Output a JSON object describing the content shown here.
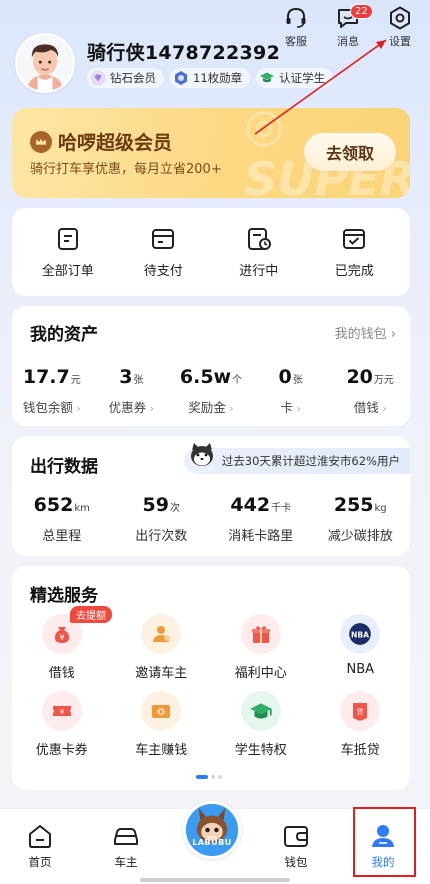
{
  "header": {
    "username": "骑行侠1478722392",
    "badges": [
      {
        "label": "钻石会员",
        "icon": "diamond-icon"
      },
      {
        "label": "11枚勋章",
        "icon": "medal-icon"
      },
      {
        "label": "认证学生",
        "icon": "graduation-cap-icon"
      }
    ],
    "top_actions": [
      {
        "label": "客服",
        "icon": "headset-icon"
      },
      {
        "label": "消息",
        "icon": "message-icon",
        "badge": "22"
      },
      {
        "label": "设置",
        "icon": "gear-icon"
      }
    ]
  },
  "vip": {
    "title": "哈啰超级会员",
    "subtitle": "骑行打车享优惠，每月立省200+",
    "button": "去领取"
  },
  "orders": [
    {
      "label": "全部订单",
      "icon": "orders-icon"
    },
    {
      "label": "待支付",
      "icon": "wallet-card-icon"
    },
    {
      "label": "进行中",
      "icon": "clock-doc-icon"
    },
    {
      "label": "已完成",
      "icon": "check-doc-icon"
    }
  ],
  "assets": {
    "title": "我的资产",
    "link": "我的钱包",
    "items": [
      {
        "value": "17.7",
        "unit": "元",
        "label": "钱包余额"
      },
      {
        "value": "3",
        "unit": "张",
        "label": "优惠券"
      },
      {
        "value": "6.5w",
        "unit": "个",
        "label": "奖励金"
      },
      {
        "value": "0",
        "unit": "张",
        "label": "卡"
      },
      {
        "value": "20",
        "unit": "万元",
        "label": "借钱"
      }
    ]
  },
  "travel": {
    "title": "出行数据",
    "banner": "过去30天累计超过淮安市62%用户",
    "items": [
      {
        "value": "652",
        "unit": "km",
        "label": "总里程"
      },
      {
        "value": "59",
        "unit": "次",
        "label": "出行次数"
      },
      {
        "value": "442",
        "unit": "千卡",
        "label": "消耗卡路里"
      },
      {
        "value": "255",
        "unit": "kg",
        "label": "减少碳排放"
      }
    ]
  },
  "services": {
    "title": "精选服务",
    "tag": "去提额",
    "items": [
      {
        "label": "借钱",
        "icon": "yuan-bag-icon"
      },
      {
        "label": "邀请车主",
        "icon": "invite-driver-icon"
      },
      {
        "label": "福利中心",
        "icon": "gift-icon"
      },
      {
        "label": "NBA",
        "icon": "nba-logo-icon"
      },
      {
        "label": "优惠卡券",
        "icon": "coupon-icon"
      },
      {
        "label": "车主赚钱",
        "icon": "driver-earn-icon"
      },
      {
        "label": "学生特权",
        "icon": "graduation-cap-icon"
      },
      {
        "label": "车抵贷",
        "icon": "car-loan-icon"
      }
    ]
  },
  "tabbar": {
    "items": [
      {
        "label": "首页",
        "icon": "home-icon"
      },
      {
        "label": "车主",
        "icon": "car-icon"
      },
      {
        "label": "",
        "icon": "labubu-icon",
        "center_text": "LABUBU"
      },
      {
        "label": "钱包",
        "icon": "wallet-icon"
      },
      {
        "label": "我的",
        "icon": "profile-icon"
      }
    ],
    "active": "我的"
  },
  "colors": {
    "accent": "#2d7bf6",
    "vip_gold": "#fcd882",
    "badge_red": "#f23c3c",
    "annotation": "#e02020"
  }
}
